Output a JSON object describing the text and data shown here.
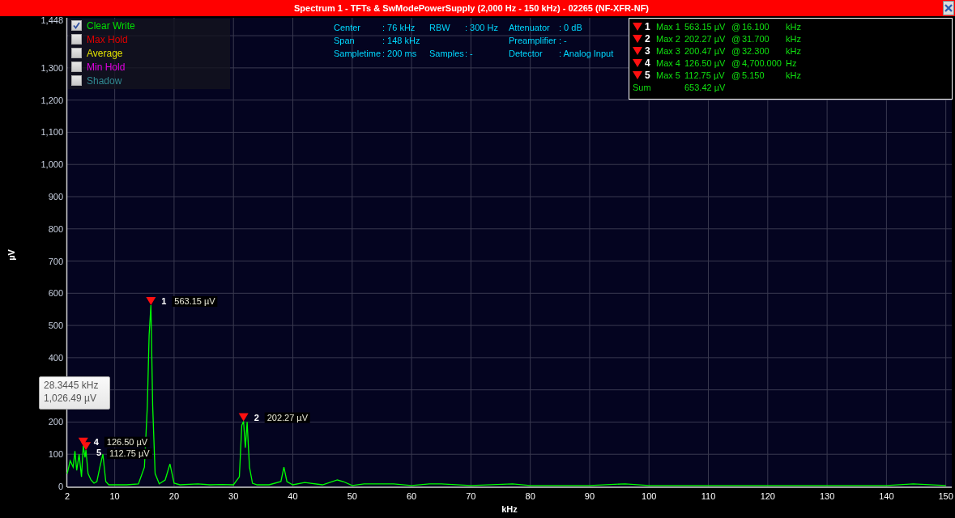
{
  "window": {
    "title": "Spectrum 1 - TFTs & SwModePowerSupply (2,000 Hz - 150 kHz) - 02265 (NF-XFR-NF)"
  },
  "legend": [
    {
      "label": "Clear Write",
      "checked": true,
      "color": "#00e000"
    },
    {
      "label": "Max Hold",
      "checked": false,
      "color": "#e00000"
    },
    {
      "label": "Average",
      "checked": false,
      "color": "#e0e000"
    },
    {
      "label": "Min Hold",
      "checked": false,
      "color": "#e000e0"
    },
    {
      "label": "Shadow",
      "checked": false,
      "color": "#308890"
    }
  ],
  "settings": {
    "columns": [
      [
        {
          "label": "Center",
          "value": ": 76 kHz"
        },
        {
          "label": "Span",
          "value": ": 148 kHz"
        },
        {
          "label": "Sampletime",
          "value": ": 200 ms"
        }
      ],
      [
        {
          "label": "RBW",
          "value": ": 300 Hz"
        },
        {
          "label": "Samples",
          "value": ": -"
        }
      ],
      [
        {
          "label": "Attenuator",
          "value": ": 0 dB"
        },
        {
          "label": "Preamplifier",
          "value": ": -"
        },
        {
          "label": "Detector",
          "value": ": Analog Input"
        }
      ]
    ]
  },
  "markers": {
    "rows": [
      {
        "number": "1",
        "name": "Max 1",
        "value": "563.15 µV",
        "at": "@",
        "frequency": "16.100",
        "unit": "kHz"
      },
      {
        "number": "2",
        "name": "Max 2",
        "value": "202.27 µV",
        "at": "@",
        "frequency": "31.700",
        "unit": "kHz"
      },
      {
        "number": "3",
        "name": "Max 3",
        "value": "200.47 µV",
        "at": "@",
        "frequency": "32.300",
        "unit": "kHz"
      },
      {
        "number": "4",
        "name": "Max 4",
        "value": "126.50 µV",
        "at": "@",
        "frequency": "4,700.000",
        "unit": "Hz"
      },
      {
        "number": "5",
        "name": "Max 5",
        "value": "112.75 µV",
        "at": "@",
        "frequency": "5.150",
        "unit": "kHz"
      }
    ],
    "sum": {
      "label": "Sum",
      "value": "653.42 µV"
    }
  },
  "tooltip": {
    "lines": [
      "28.3445 kHz",
      "1,026.49 µV"
    ]
  },
  "plot_marker_numbers": [
    "1",
    "2",
    "4",
    "5"
  ],
  "chart_data": {
    "type": "line",
    "grid": true,
    "xlabel": "kHz",
    "ylabel": "µV",
    "xlim": [
      2,
      151
    ],
    "ylim": [
      0,
      1448
    ],
    "xticks": [
      2,
      10,
      20,
      30,
      40,
      50,
      60,
      70,
      80,
      90,
      100,
      110,
      120,
      130,
      140,
      150
    ],
    "yticks": [
      0,
      100,
      200,
      400,
      500,
      600,
      700,
      800,
      900,
      {
        "value": 1000,
        "label": "1,000"
      },
      {
        "value": 1100,
        "label": "1,100"
      },
      {
        "value": 1200,
        "label": "1,200"
      },
      {
        "value": 1300,
        "label": "1,300"
      },
      {
        "value": 1448,
        "label": "1,448"
      }
    ],
    "x": [
      2,
      2.5,
      3,
      3.3,
      3.6,
      4,
      4.4,
      4.7,
      5,
      5.15,
      5.5,
      6,
      6.5,
      7,
      7.5,
      8,
      8.5,
      9,
      10,
      12,
      14,
      15,
      15.5,
      15.8,
      16.1,
      16.4,
      16.8,
      17.5,
      18.5,
      19.3,
      20,
      21,
      24,
      26,
      28,
      30,
      31,
      31.4,
      31.7,
      32,
      32.3,
      32.7,
      33.2,
      34,
      36,
      38,
      38.5,
      39,
      40,
      42,
      45,
      47.5,
      48.5,
      50,
      52,
      57,
      60,
      63,
      65,
      70,
      77,
      80,
      90,
      96,
      100,
      110,
      120,
      130,
      140,
      144.5,
      150
    ],
    "series": [
      {
        "color": "#00ff00",
        "values": [
          40,
          80,
          60,
          110,
          50,
          100,
          30,
          126,
          90,
          113,
          40,
          20,
          10,
          15,
          60,
          100,
          15,
          5,
          5,
          5,
          8,
          60,
          250,
          470,
          563,
          250,
          40,
          8,
          20,
          70,
          10,
          5,
          8,
          5,
          6,
          5,
          30,
          190,
          202,
          120,
          200,
          60,
          10,
          5,
          5,
          15,
          60,
          15,
          5,
          12,
          5,
          20,
          15,
          3,
          8,
          8,
          3,
          8,
          8,
          3,
          8,
          3,
          3,
          8,
          3,
          3,
          3,
          3,
          3,
          8,
          3
        ]
      }
    ],
    "annotations": [
      {
        "x": 16.1,
        "y": 563.15,
        "text": "563.15 µV"
      },
      {
        "x": 31.7,
        "y": 202.27,
        "text": "202.27 µV"
      },
      {
        "x": 4.7,
        "y": 126.5,
        "text": "126.50 µV"
      },
      {
        "x": 5.15,
        "y": 112.75,
        "text": "112.75 µV"
      }
    ]
  }
}
